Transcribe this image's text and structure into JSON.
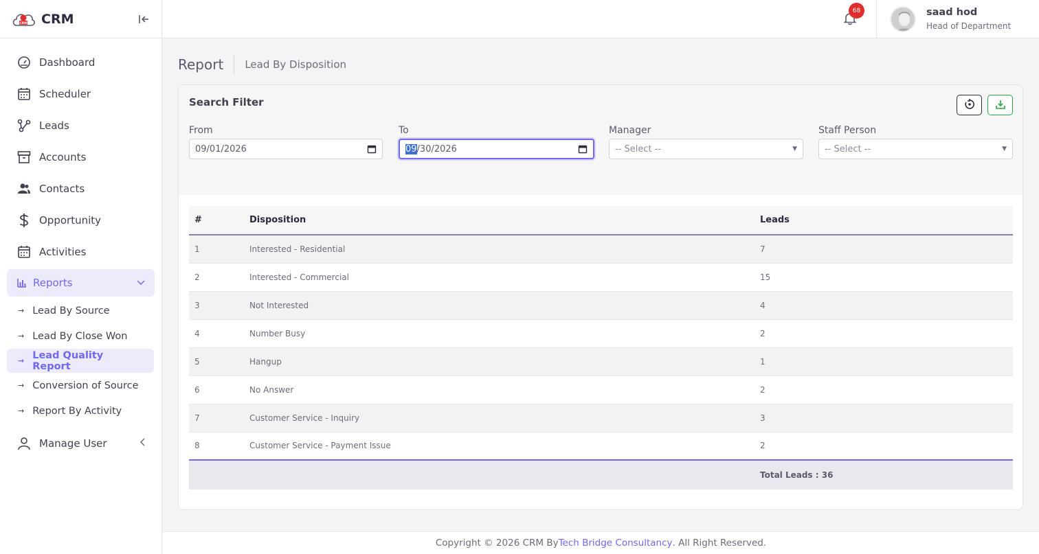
{
  "brand": {
    "name": "CRM"
  },
  "sidebar": {
    "items": [
      {
        "label": "Dashboard",
        "icon": "gauge-icon"
      },
      {
        "label": "Scheduler",
        "icon": "calendar-icon"
      },
      {
        "label": "Leads",
        "icon": "share-nodes-icon"
      },
      {
        "label": "Accounts",
        "icon": "archive-box-icon"
      },
      {
        "label": "Contacts",
        "icon": "users-icon"
      },
      {
        "label": "Opportunity",
        "icon": "dollar-icon"
      },
      {
        "label": "Activities",
        "icon": "calendar-icon"
      },
      {
        "label": "Reports",
        "icon": "bar-chart-icon"
      }
    ],
    "report_subitems": [
      {
        "label": "Lead By Source"
      },
      {
        "label": "Lead By Close Won"
      },
      {
        "label": "Lead Quality Report"
      },
      {
        "label": "Conversion of Source"
      },
      {
        "label": "Report By Activity"
      }
    ],
    "manage_user": {
      "label": "Manage User",
      "icon": "user-icon"
    }
  },
  "topbar": {
    "notification_count": "68",
    "user_name": "saad hod",
    "user_role": "Head of Department"
  },
  "page": {
    "title": "Report",
    "subtitle": "Lead By Disposition"
  },
  "filter": {
    "title": "Search Filter",
    "from_label": "From",
    "from_value": "09/01/2026",
    "to_label": "To",
    "to_value_selected": "09",
    "to_value_rest": "/30/2026",
    "manager_label": "Manager",
    "manager_value": "-- Select --",
    "staff_label": "Staff Person",
    "staff_value": "-- Select --"
  },
  "table": {
    "headers": [
      "#",
      "Disposition",
      "Leads"
    ],
    "rows": [
      {
        "num": "1",
        "disposition": "Interested - Residential",
        "leads": "7"
      },
      {
        "num": "2",
        "disposition": "Interested - Commercial",
        "leads": "15"
      },
      {
        "num": "3",
        "disposition": "Not Interested",
        "leads": "4"
      },
      {
        "num": "4",
        "disposition": "Number Busy",
        "leads": "2"
      },
      {
        "num": "5",
        "disposition": "Hangup",
        "leads": "1"
      },
      {
        "num": "6",
        "disposition": "No Answer",
        "leads": "2"
      },
      {
        "num": "7",
        "disposition": "Customer Service - Inquiry",
        "leads": "3"
      },
      {
        "num": "8",
        "disposition": "Customer Service - Payment Issue",
        "leads": "2"
      }
    ],
    "total_label": "Total Leads : 36"
  },
  "footer": {
    "prefix": "Copyright © 2026 CRM By ",
    "link": "Tech Bridge Consultancy",
    "suffix": ". All Right Reserved."
  },
  "colors": {
    "accent": "#7367f0",
    "badge": "#e12d2d",
    "export": "#28a745"
  }
}
